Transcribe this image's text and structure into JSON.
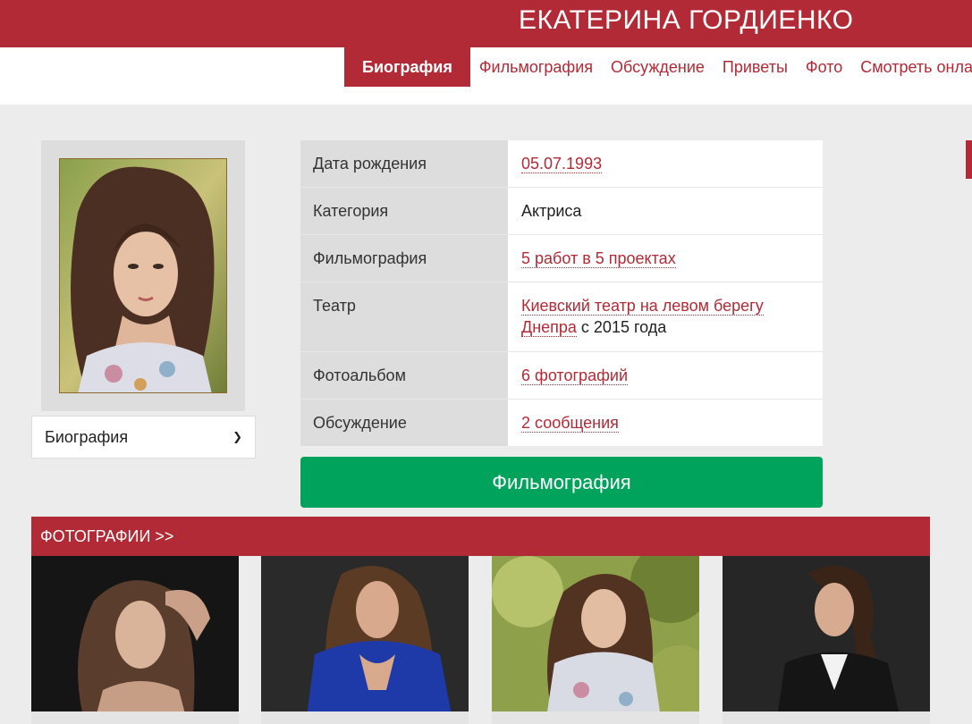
{
  "header": {
    "title": "ЕКАТЕРИНА ГОРДИЕНКО"
  },
  "nav": {
    "tabs": [
      {
        "label": "Биография",
        "active": true
      },
      {
        "label": "Фильмография"
      },
      {
        "label": "Обсуждение"
      },
      {
        "label": "Приветы"
      },
      {
        "label": "Фото"
      },
      {
        "label": "Смотреть онлайн"
      }
    ]
  },
  "section_select": {
    "value": "Биография"
  },
  "info": {
    "birth_label": "Дата рождения",
    "birth_value": "05.07.1993",
    "category_label": "Категория",
    "category_value": "Актриса",
    "filmography_label": "Фильмография",
    "filmography_value": "5 работ в 5 проектах",
    "theatre_label": "Театр",
    "theatre_link": "Киевский театр на левом берегу Днепра",
    "theatre_suffix": " с 2015 года",
    "album_label": "Фотоальбом",
    "album_value": "6 фотографий",
    "discussion_label": "Обсуждение",
    "discussion_value": "2 сообщения"
  },
  "filmography_button": "Фильмография",
  "photos_header": "ФОТОГРАФИИ >>",
  "colors": {
    "brand": "#b22a35",
    "green": "#00a35c"
  }
}
